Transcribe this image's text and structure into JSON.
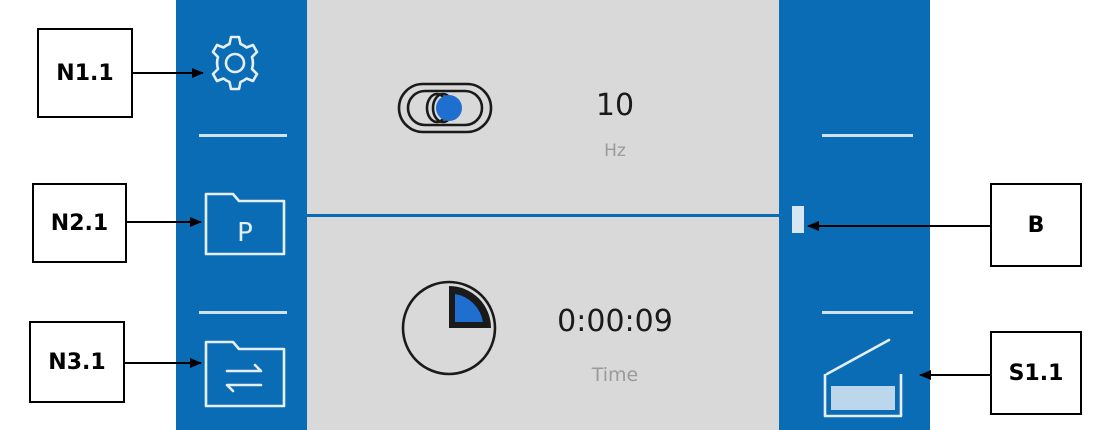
{
  "callouts": {
    "n1": "N1.1",
    "n2": "N2.1",
    "n3": "N3.1",
    "b": "B",
    "s1": "S1.1"
  },
  "frequency": {
    "value": "10",
    "unit": "Hz"
  },
  "time": {
    "value": "0:00:09",
    "label": "Time"
  },
  "icons": {
    "settings": "gear-icon",
    "program": "folder-p-icon",
    "transfer": "folder-swap-icon",
    "vibration": "vibration-icon",
    "timer": "pie-clock-icon",
    "tray": "tray-icon"
  },
  "colors": {
    "panel_blue": "#0b6cb6",
    "main_gray": "#d9d9d9",
    "accent_blue": "#1e6fd0"
  }
}
